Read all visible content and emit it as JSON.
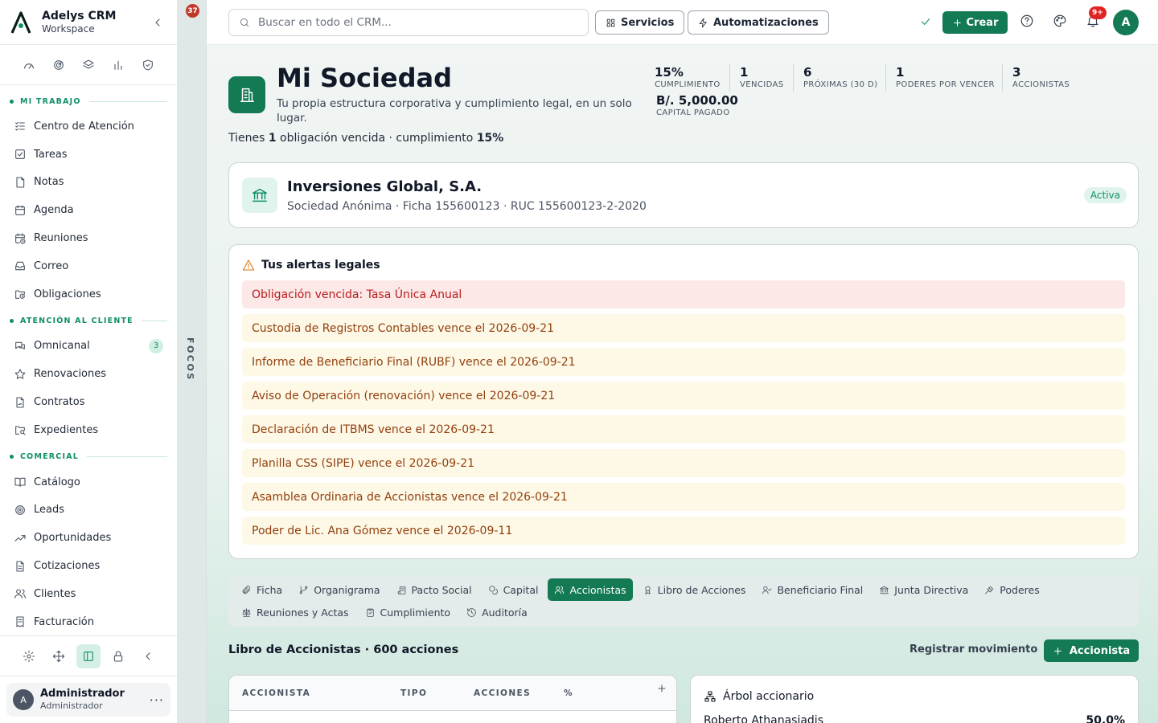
{
  "app": {
    "name": "Adelys CRM",
    "workspace": "Workspace"
  },
  "sidebar": {
    "sections": [
      {
        "label": "MI TRABAJO",
        "items": [
          {
            "label": "Centro de Atención",
            "icon": "list-check-icon"
          },
          {
            "label": "Tareas",
            "icon": "checkbox-icon"
          },
          {
            "label": "Notas",
            "icon": "note-icon"
          },
          {
            "label": "Agenda",
            "icon": "calendar-icon"
          },
          {
            "label": "Reuniones",
            "icon": "calendar-clock-icon"
          },
          {
            "label": "Correo",
            "icon": "inbox-icon"
          },
          {
            "label": "Obligaciones",
            "icon": "folder-clock-icon"
          }
        ]
      },
      {
        "label": "ATENCIÓN AL CLIENTE",
        "items": [
          {
            "label": "Omnicanal",
            "icon": "chat-icon",
            "badge": "3"
          },
          {
            "label": "Renovaciones",
            "icon": "star-icon"
          },
          {
            "label": "Contratos",
            "icon": "file-signature-icon"
          },
          {
            "label": "Expedientes",
            "icon": "folder-search-icon"
          }
        ]
      },
      {
        "label": "COMERCIAL",
        "items": [
          {
            "label": "Catálogo",
            "icon": "book-open-icon"
          },
          {
            "label": "Leads",
            "icon": "target-icon"
          },
          {
            "label": "Oportunidades",
            "icon": "trending-up-icon"
          },
          {
            "label": "Cotizaciones",
            "icon": "file-text-icon"
          },
          {
            "label": "Clientes",
            "icon": "users-icon"
          },
          {
            "label": "Facturación",
            "icon": "receipt-icon"
          }
        ]
      }
    ],
    "user": {
      "initial": "A",
      "name": "Administrador",
      "role": "Administrador"
    }
  },
  "focos": {
    "count": "37",
    "label": "FOCOS"
  },
  "topbar": {
    "search_placeholder": "Buscar en todo el CRM...",
    "servicios": "Servicios",
    "automatizaciones": "Automatizaciones",
    "crear": "Crear",
    "notif_badge": "9+",
    "avatar": "A"
  },
  "header": {
    "title": "Mi Sociedad",
    "subtitle": "Tu propia estructura corporativa y cumplimiento legal, en un solo lugar.",
    "summary_pre": "Tienes ",
    "summary_count": "1",
    "summary_mid": " obligación vencida · cumplimiento ",
    "summary_pct": "15%"
  },
  "stats": [
    {
      "value": "15%",
      "label": "CUMPLIMIENTO"
    },
    {
      "value": "1",
      "label": "VENCIDAS"
    },
    {
      "value": "6",
      "label": "PRÓXIMAS (30 D)"
    },
    {
      "value": "1",
      "label": "PODERES POR VENCER"
    },
    {
      "value": "3",
      "label": "ACCIONISTAS"
    },
    {
      "value": "B/. 5,000.00",
      "label": "CAPITAL PAGADO"
    }
  ],
  "company": {
    "name": "Inversiones Global, S.A.",
    "meta": "Sociedad Anónima · Ficha 155600123 · RUC 155600123-2-2020",
    "status": "Activa"
  },
  "alerts": {
    "title": "Tus alertas legales",
    "items": [
      {
        "text": "Obligación vencida: Tasa Única Anual",
        "level": "red"
      },
      {
        "text": "Custodia de Registros Contables vence el 2026-09-21",
        "level": "amber"
      },
      {
        "text": "Informe de Beneficiario Final (RUBF) vence el 2026-09-21",
        "level": "amber"
      },
      {
        "text": "Aviso de Operación (renovación) vence el 2026-09-21",
        "level": "amber"
      },
      {
        "text": "Declaración de ITBMS vence el 2026-09-21",
        "level": "amber"
      },
      {
        "text": "Planilla CSS (SIPE) vence el 2026-09-21",
        "level": "amber"
      },
      {
        "text": "Asamblea Ordinaria de Accionistas vence el 2026-09-21",
        "level": "amber"
      },
      {
        "text": "Poder de Lic. Ana Gómez vence el 2026-09-11",
        "level": "amber"
      }
    ]
  },
  "tabs": [
    {
      "label": "Ficha",
      "icon": "paperclip-icon"
    },
    {
      "label": "Organigrama",
      "icon": "git-branch-icon"
    },
    {
      "label": "Pacto Social",
      "icon": "scroll-icon"
    },
    {
      "label": "Capital",
      "icon": "coins-icon"
    },
    {
      "label": "Accionistas",
      "icon": "users-icon",
      "active": true
    },
    {
      "label": "Libro de Acciones",
      "icon": "award-icon"
    },
    {
      "label": "Beneficiario Final",
      "icon": "user-check-icon"
    },
    {
      "label": "Junta Directiva",
      "icon": "landmark-icon"
    },
    {
      "label": "Poderes",
      "icon": "gavel-icon"
    },
    {
      "label": "Reuniones y Actas",
      "icon": "scale-icon"
    },
    {
      "label": "Cumplimiento",
      "icon": "clipboard-check-icon"
    },
    {
      "label": "Auditoría",
      "icon": "history-icon"
    }
  ],
  "libro": {
    "title": "Libro de Accionistas · 600 acciones",
    "register": "Registrar movimiento",
    "add": "Accionista",
    "columns": [
      "ACCIONISTA",
      "TIPO",
      "ACCIONES",
      "%"
    ]
  },
  "tree": {
    "title": "Árbol accionario",
    "first_name": "Roberto Athanasiadis",
    "first_pct": "50.0%"
  },
  "colors": {
    "brand": "#137a53",
    "accent": "#0f8f6a",
    "danger": "#b91c1c",
    "warning": "#92400e"
  }
}
